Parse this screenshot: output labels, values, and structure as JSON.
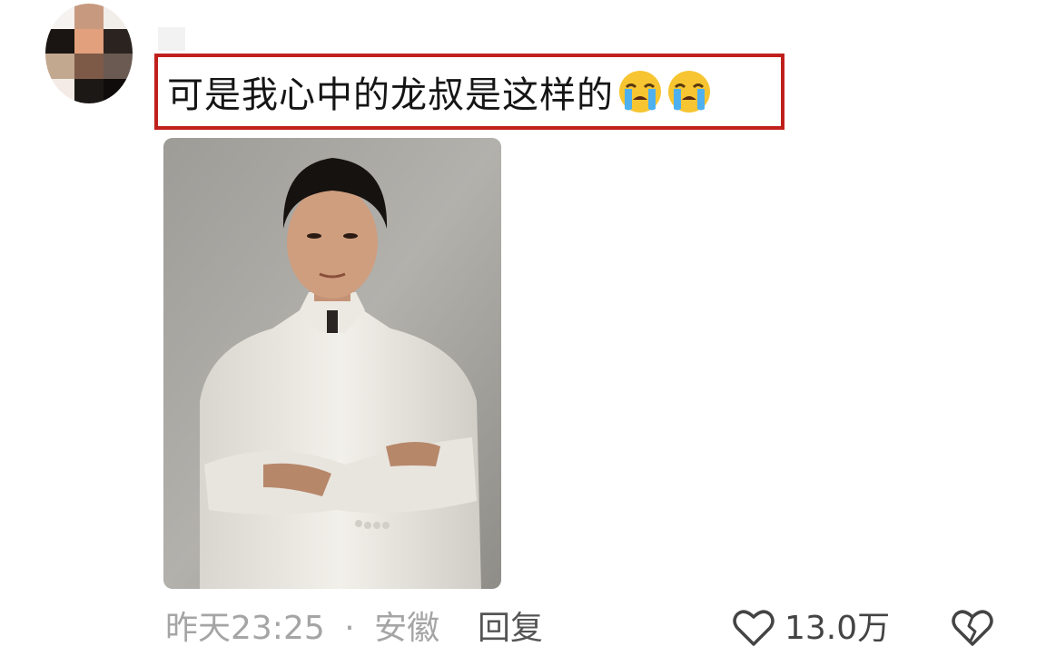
{
  "comment": {
    "text": "可是我心中的龙叔是这样的",
    "emoji": [
      "loudly-crying-face",
      "loudly-crying-face"
    ]
  },
  "meta": {
    "time": "昨天23:25",
    "separator": "·",
    "location": "安徽"
  },
  "actions": {
    "reply_label": "回复",
    "like_count": "13.0万"
  },
  "colors": {
    "highlight_border": "#c0201c",
    "meta_text": "#a5a5a5"
  }
}
